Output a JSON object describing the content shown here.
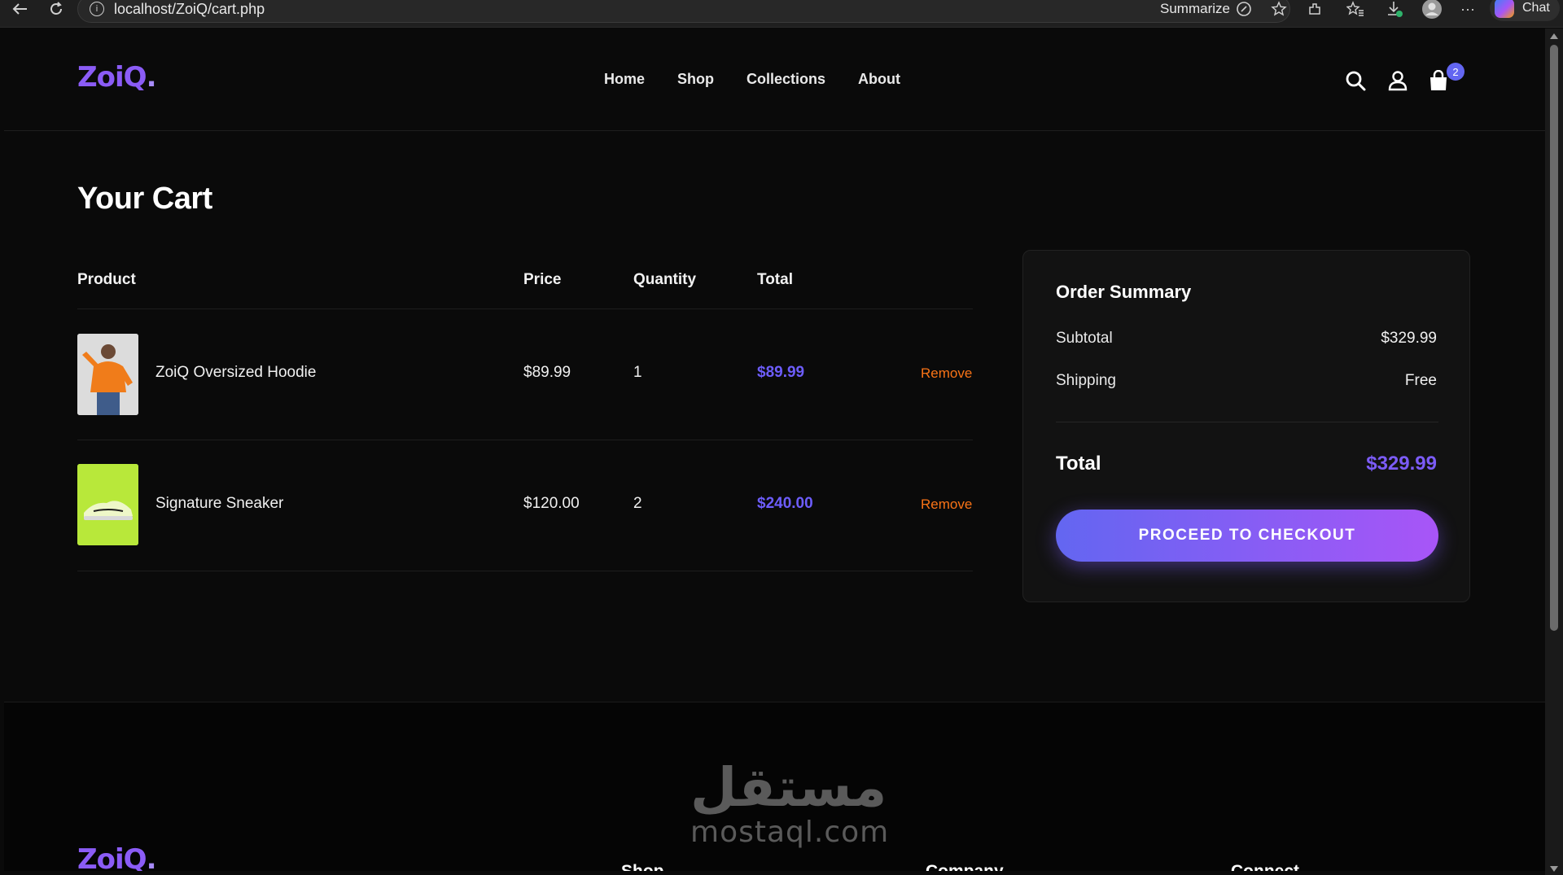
{
  "browser": {
    "url": "localhost/ZoiQ/cart.php",
    "summarize_label": "Summarize",
    "chat_label": "Chat"
  },
  "header": {
    "logo": "ZoiQ",
    "logo_dot": ".",
    "nav": [
      "Home",
      "Shop",
      "Collections",
      "About"
    ],
    "cart_count": "2"
  },
  "cart": {
    "title": "Your Cart",
    "columns": {
      "product": "Product",
      "price": "Price",
      "quantity": "Quantity",
      "total": "Total"
    },
    "items": [
      {
        "name": "ZoiQ Oversized Hoodie",
        "price": "$89.99",
        "quantity": "1",
        "total": "$89.99",
        "remove": "Remove",
        "image_color": "#d9d9d9"
      },
      {
        "name": "Signature Sneaker",
        "price": "$120.00",
        "quantity": "2",
        "total": "$240.00",
        "remove": "Remove",
        "image_color": "#b8e83a"
      }
    ]
  },
  "summary": {
    "title": "Order Summary",
    "subtotal_label": "Subtotal",
    "subtotal_value": "$329.99",
    "shipping_label": "Shipping",
    "shipping_value": "Free",
    "total_label": "Total",
    "total_value": "$329.99",
    "checkout_label": "PROCEED TO CHECKOUT"
  },
  "footer": {
    "logo": "ZoiQ",
    "logo_dot": ".",
    "columns": [
      "Shop",
      "Company",
      "Connect"
    ],
    "watermark_ar": "مستقل",
    "watermark_en": "mostaql.com"
  },
  "colors": {
    "accent": "#6d5dfc",
    "remove": "#f97316",
    "background": "#0a0a0a"
  }
}
